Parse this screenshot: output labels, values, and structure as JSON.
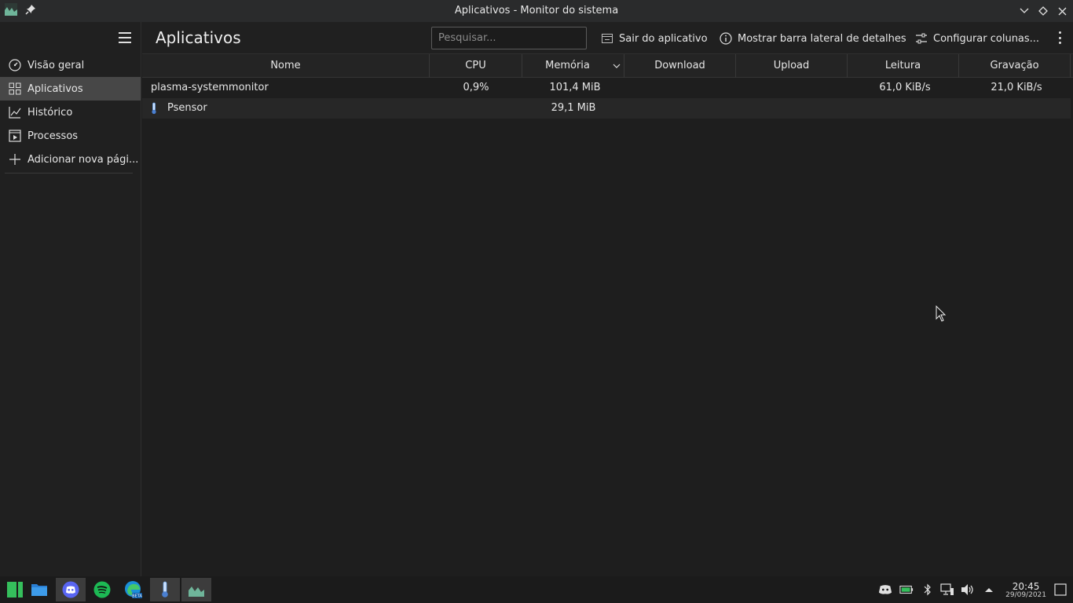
{
  "window": {
    "title": "Aplicativos - Monitor do sistema"
  },
  "sidebar": {
    "items": [
      {
        "label": "Visão geral",
        "icon": "dashboard-icon"
      },
      {
        "label": "Aplicativos",
        "icon": "grid-icon",
        "active": true
      },
      {
        "label": "Histórico",
        "icon": "chart-icon"
      },
      {
        "label": "Processos",
        "icon": "process-icon"
      },
      {
        "label": "Adicionar nova pági...",
        "icon": "plus-icon"
      }
    ]
  },
  "header": {
    "title": "Aplicativos",
    "search_placeholder": "Pesquisar...",
    "quit_label": "Sair do aplicativo",
    "details_label": "Mostrar barra lateral de detalhes",
    "columns_label": "Configurar colunas..."
  },
  "table": {
    "columns": [
      "Nome",
      "CPU",
      "Memória",
      "Download",
      "Upload",
      "Leitura",
      "Gravação"
    ],
    "sorted_column": "Memória",
    "rows": [
      {
        "name": "plasma-systemmonitor",
        "cpu": "0,9%",
        "memory": "101,4 MiB",
        "download": "",
        "upload": "",
        "read": "61,0 KiB/s",
        "write": "21,0 KiB/s",
        "has_icon": false
      },
      {
        "name": "Psensor",
        "cpu": "",
        "memory": "29,1 MiB",
        "download": "",
        "upload": "",
        "read": "",
        "write": "",
        "has_icon": true
      }
    ]
  },
  "taskbar": {
    "apps": [
      "manjaro-menu-icon",
      "file-manager-icon",
      "discord-icon",
      "spotify-icon",
      "edge-beta-icon",
      "psensor-icon",
      "system-monitor-icon"
    ],
    "clock": {
      "time": "20:45",
      "date": "29/09/2021"
    }
  },
  "colors": {
    "accent_active": "#474747",
    "background": "#1e1e1e",
    "discord": "#5865f2",
    "spotify": "#1db954",
    "manjaro": "#35bf5c"
  }
}
